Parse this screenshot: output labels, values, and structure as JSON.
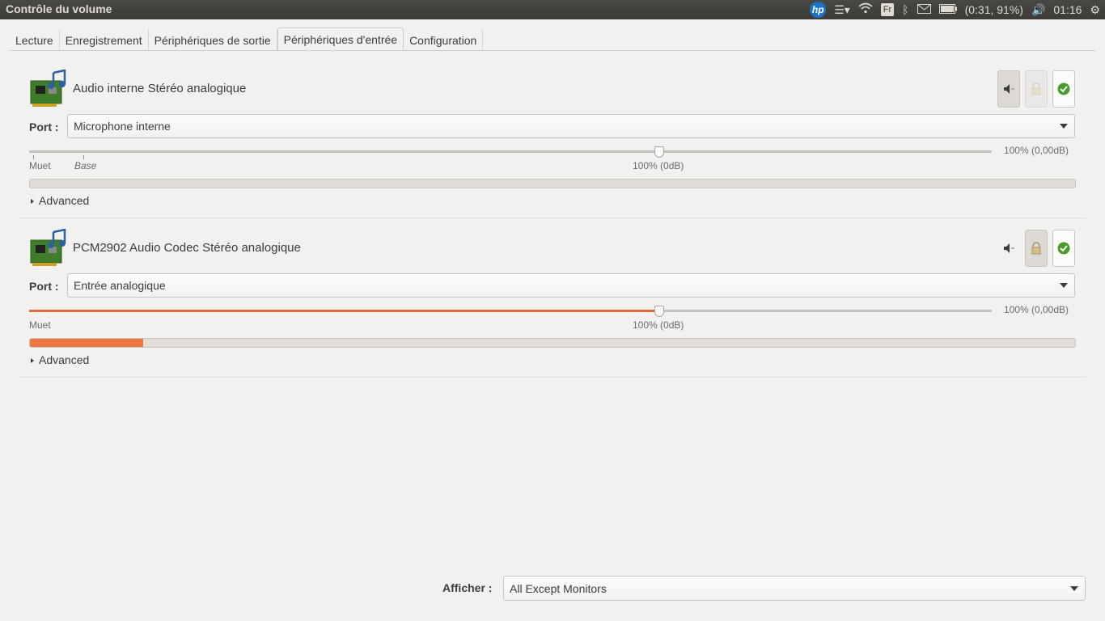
{
  "window": {
    "title": "Contrôle du volume"
  },
  "tray": {
    "battery_text": "(0:31, 91%)",
    "clock": "01:16",
    "keyboard_layout": "Fr"
  },
  "tabs": [
    {
      "label": "Lecture"
    },
    {
      "label": "Enregistrement"
    },
    {
      "label": "Périphériques de sortie"
    },
    {
      "label": "Périphériques d'entrée",
      "active": true
    },
    {
      "label": "Configuration"
    }
  ],
  "devices": [
    {
      "name": "Audio interne Stéréo analogique",
      "port_label": "Port :",
      "port_value": "Microphone interne",
      "volume_text": "100% (0,00dB)",
      "volume_fraction": 0.655,
      "tick_mute": "Muet",
      "tick_base": "Base",
      "tick_100": "100% (0dB)",
      "level_fraction": 0.0,
      "advanced": "Advanced",
      "mute_pressed": true,
      "lock_enabled": false
    },
    {
      "name": "PCM2902 Audio Codec Stéréo analogique",
      "port_label": "Port :",
      "port_value": "Entrée analogique",
      "volume_text": "100% (0,00dB)",
      "volume_fraction": 0.655,
      "tick_mute": "Muet",
      "tick_100": "100% (0dB)",
      "level_fraction": 0.108,
      "advanced": "Advanced",
      "mute_pressed": false,
      "lock_enabled": true
    }
  ],
  "footer": {
    "show_label": "Afficher :",
    "show_value": "All Except Monitors"
  },
  "colors": {
    "accent": "#ef7745",
    "panel": "#3c3b37",
    "background": "#f2f1f0"
  }
}
